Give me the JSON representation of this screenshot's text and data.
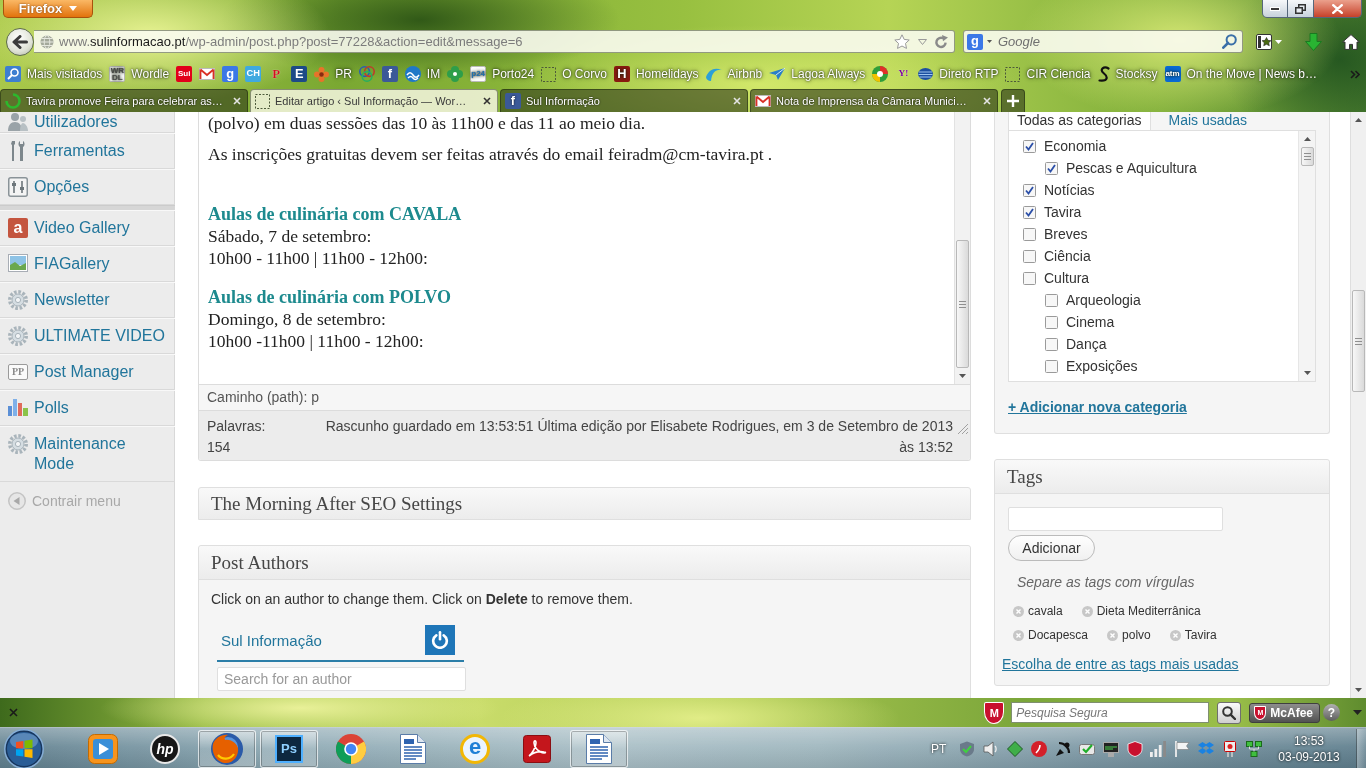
{
  "browser": {
    "menu_button": "Firefox",
    "address": "www.**sulinformacao.pt**/wp-admin/post.php?post=77228&action=edit&message=6",
    "search": {
      "badge": "g",
      "placeholder": "Google"
    }
  },
  "bookmarks": [
    {
      "kind": "search",
      "label": "Mais visitados"
    },
    {
      "kind": "letter",
      "badge": "WR DL",
      "color": "#4a4a4a",
      "label": "Wordle"
    },
    {
      "kind": "tile",
      "badge": "Sui",
      "color": "#e2001a"
    },
    {
      "kind": "mail"
    },
    {
      "kind": "tile",
      "badge": "g",
      "color": "#3b78e7"
    },
    {
      "kind": "tile",
      "badge": "CH",
      "color": "#3fa9e0"
    },
    {
      "kind": "glyph",
      "badge": "P",
      "color": "#d0101c"
    },
    {
      "kind": "tile",
      "badge": "E",
      "color": "#1d4a87"
    },
    {
      "kind": "flower",
      "label": "PR"
    },
    {
      "kind": "rings"
    },
    {
      "kind": "tile",
      "badge": "f",
      "color": "#3b5998"
    },
    {
      "kind": "wave",
      "label": "IM"
    },
    {
      "kind": "clover"
    },
    {
      "kind": "letter",
      "badge": "p24",
      "color": "#1f6fb2",
      "label": "Porto24"
    },
    {
      "kind": "dashed",
      "label": "O Corvo"
    },
    {
      "kind": "tile",
      "badge": "H",
      "color": "#8b1a10",
      "label": "Homelidays"
    },
    {
      "kind": "swoosh",
      "label": "Airbnb"
    },
    {
      "kind": "bird",
      "label": "Lagoa Always"
    },
    {
      "kind": "target"
    },
    {
      "kind": "glyph",
      "badge": "Y!",
      "color": "#7b0099"
    },
    {
      "kind": "disc",
      "label": "Direto RTP"
    },
    {
      "kind": "dashed",
      "label": "CIR Ciencia"
    },
    {
      "kind": "swirl",
      "label": "Stocksy"
    },
    {
      "kind": "tile",
      "badge": "atm",
      "color": "#0a6ad3",
      "label": "On the Move | News b…"
    }
  ],
  "tabs": [
    {
      "kind": "spinner",
      "title": "Tavira promove Feira para celebrar as…",
      "selected": false
    },
    {
      "kind": "dashed",
      "title": "Editar artigo ‹ Sul Informação — Wor…",
      "selected": true
    },
    {
      "kind": "tile",
      "badge": "f",
      "color": "#3b5998",
      "title": "Sul Informação",
      "selected": false
    },
    {
      "kind": "mail",
      "title": "Nota de Imprensa da Câmara Munici…",
      "selected": false
    }
  ],
  "wp": {
    "admin_menu": {
      "groups": [
        {
          "items": [
            {
              "kind": "users",
              "label": "Utilizadores"
            },
            {
              "kind": "tools",
              "label": "Ferramentas"
            },
            {
              "kind": "options",
              "label": "Opções"
            }
          ]
        },
        {
          "items": [
            {
              "kind": "badge",
              "badge": "a",
              "label": "Video Gallery"
            },
            {
              "kind": "picture",
              "label": "FIAGallery"
            },
            {
              "kind": "gear",
              "label": "Newsletter"
            },
            {
              "kind": "gear",
              "label": "ULTIMATE VIDEO"
            },
            {
              "kind": "frame",
              "badge": "PP",
              "label": "Post Manager"
            },
            {
              "kind": "chart",
              "label": "Polls"
            },
            {
              "kind": "gear",
              "label": "Maintenance Mode"
            }
          ]
        }
      ],
      "collapse": "Contrair menu"
    },
    "editor": {
      "blocks": [
        {
          "kind": "paragraph",
          "text": "(polvo) em duas sessões das 10 às 11h00 e das 11 ao meio dia."
        },
        {
          "kind": "paragraph",
          "text": "As inscrições gratuitas devem ser feitas através do email feiradm@cm-tavira.pt ."
        },
        {
          "kind": "schedule",
          "heading": "Aulas de culinária com CAVALA",
          "lines": [
            "Sábado, 7 de setembro:",
            "10h00 - 11h00 | 11h00 - 12h00:"
          ]
        },
        {
          "kind": "schedule",
          "heading": "Aulas de culinária com POLVO",
          "lines": [
            "Domingo, 8 de setembro:",
            "10h00 -11h00 | 11h00 - 12h00:"
          ]
        }
      ],
      "path": "Caminho (path): p",
      "word_count_label": "Palavras:",
      "word_count": "154",
      "autosave": "Rascunho guardado em 13:53:51 Última edição por Elisabete Rodrigues, em 3 de Setembro de 2013 às 13:52"
    },
    "seo_panel": {
      "title": "The Morning After SEO Settings"
    },
    "authors_panel": {
      "title": "Post Authors",
      "hint": "Click on an author to change them. Click on **Delete** to remove them.",
      "authors": [
        {
          "name": "Sul Informação"
        }
      ],
      "search": {
        "placeholder": "Search for an author"
      }
    },
    "categories": {
      "tabs": [
        {
          "label": "Todas as categorias",
          "selected": true
        },
        {
          "label": "Mais usadas",
          "selected": false
        }
      ],
      "items": [
        {
          "label": "Economia",
          "checked": true,
          "children": [
            {
              "label": "Pescas e Aquicultura",
              "checked": true
            }
          ]
        },
        {
          "label": "Notícias",
          "checked": true
        },
        {
          "label": "Tavira",
          "checked": true
        },
        {
          "label": "Breves",
          "checked": false
        },
        {
          "label": "Ciência",
          "checked": false
        },
        {
          "label": "Cultura",
          "checked": false,
          "children": [
            {
              "label": "Arqueologia",
              "checked": false
            },
            {
              "label": "Cinema",
              "checked": false
            },
            {
              "label": "Dança",
              "checked": false
            },
            {
              "label": "Exposições",
              "checked": false
            }
          ]
        }
      ],
      "add_link": "+ Adicionar nova categoria"
    },
    "tags_panel": {
      "title": "Tags",
      "add_button": "Adicionar",
      "hint": "Separe as tags com vírgulas",
      "tags": [
        "cavala",
        "Dieta Mediterrânica",
        "Docapesca",
        "polvo",
        "Tavira"
      ],
      "most_used_link": "Escolha de entre as tags mais usadas"
    }
  },
  "addon_bar": {
    "shield_badge": "M",
    "search_placeholder": "Pesquisa Segura",
    "brand_badge": "M",
    "brand_button": "McAfee",
    "help": "?"
  },
  "taskbar": {
    "apps": [
      {
        "kind": "media",
        "running": false
      },
      {
        "kind": "logo",
        "badge": "hp",
        "running": false
      },
      {
        "kind": "firefox",
        "running": true
      },
      {
        "kind": "tile",
        "badge": "Ps",
        "running": true
      },
      {
        "kind": "chrome",
        "running": false
      },
      {
        "kind": "document",
        "running": false
      },
      {
        "kind": "explorer",
        "badge": "e",
        "running": false
      },
      {
        "kind": "acrobat",
        "running": false
      },
      {
        "kind": "document",
        "running": true
      }
    ],
    "language": "PT",
    "time": "13:53",
    "date": "03-09-2013"
  }
}
